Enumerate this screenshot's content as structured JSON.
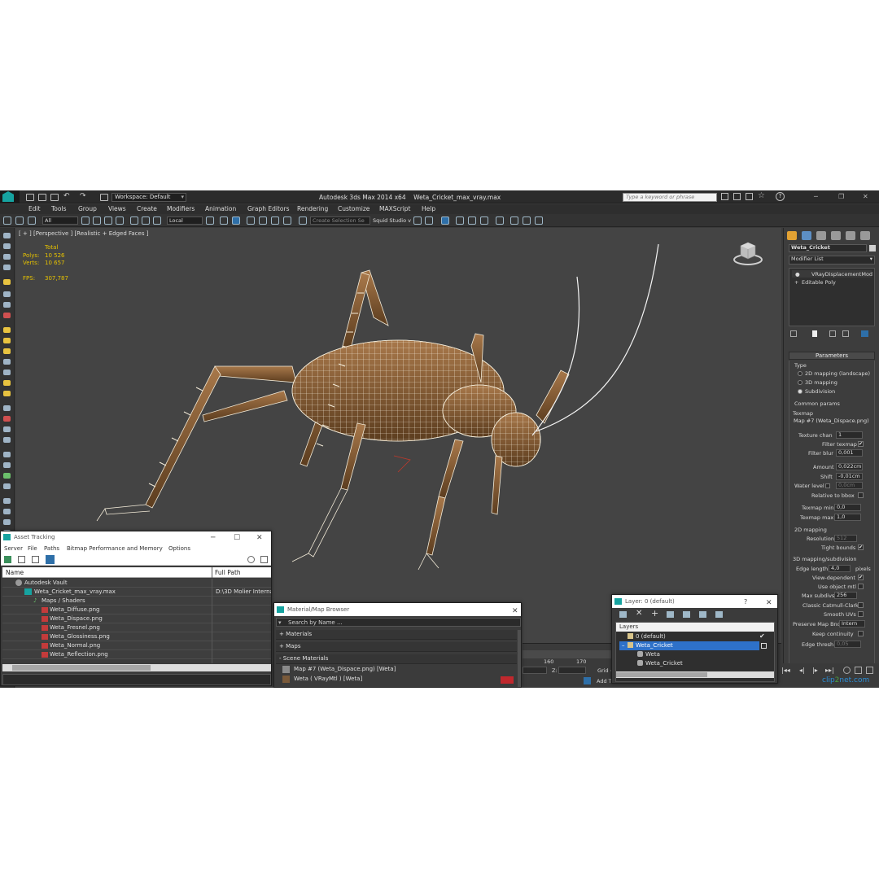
{
  "titlebar": {
    "workspace": "Workspace: Default",
    "app_title": "Autodesk 3ds Max  2014 x64",
    "file_title": "Weta_Cricket_max_vray.max",
    "search_placeholder": "Type a keyword or phrase"
  },
  "menubar": [
    "Edit",
    "Tools",
    "Group",
    "Views",
    "Create",
    "Modifiers",
    "Animation",
    "Graph Editors",
    "Rendering",
    "Customize",
    "MAXScript",
    "Help"
  ],
  "toolbar": {
    "filter_value": "All",
    "coord_value": "Local",
    "selection_set_placeholder": "Create Selection Se",
    "squid_label": "Squid Studio v"
  },
  "viewport": {
    "label": "[ + ] [Perspective ] [Realistic + Edged Faces ]",
    "stats_header": "Total",
    "polys_label": "Polys:",
    "polys_value": "10 526",
    "verts_label": "Verts:",
    "verts_value": "10 657",
    "fps_label": "FPS:",
    "fps_value": "307,787"
  },
  "command_panel": {
    "object_name": "Weta_Cricket",
    "modifier_list": "Modifier List",
    "stack": [
      "VRayDisplacementMod",
      "Editable Poly"
    ],
    "parameters_title": "Parameters",
    "type_label": "Type",
    "type_options": [
      "2D mapping (landscape)",
      "3D mapping",
      "Subdivision"
    ],
    "type_selected": "Subdivision",
    "common_params": "Common params",
    "texmap_label": "Texmap",
    "texmap_value": "Map #7 (Weta_Dispace.png)",
    "texture_chan_label": "Texture chan",
    "texture_chan_value": "1",
    "filter_texmap_label": "Filter texmap",
    "filter_blur_label": "Filter blur",
    "filter_blur_value": "0,001",
    "amount_label": "Amount",
    "amount_value": "0,022cm",
    "shift_label": "Shift",
    "shift_value": "-0,01cm",
    "water_level_label": "Water level",
    "water_level_value": "0,0cm",
    "relative_bbox_label": "Relative to bbox",
    "texmap_min_label": "Texmap min",
    "texmap_min_value": "0,0",
    "texmap_max_label": "Texmap max",
    "texmap_max_value": "1,0",
    "mapping2d_title": "2D mapping",
    "resolution_label": "Resolution",
    "resolution_value": "512",
    "tight_bounds_label": "Tight bounds",
    "mapping3d_title": "3D mapping/subdivision",
    "edge_length_label": "Edge length",
    "edge_length_value": "4,0",
    "pixels_label": "pixels",
    "view_dependent_label": "View-dependent",
    "use_object_mtl_label": "Use object mtl",
    "max_subdivs_label": "Max subdivs",
    "max_subdivs_value": "256",
    "classic_catmull_label": "Classic Catmull-Clark",
    "smooth_uvs_label": "Smooth UVs",
    "preserve_map_label": "Preserve Map Bnd",
    "preserve_map_value": "Intern",
    "keep_continuity_label": "Keep continuity",
    "edge_thresh_label": "Edge thresh",
    "edge_thresh_value": "0,05"
  },
  "asset_tracking": {
    "title": "Asset Tracking",
    "menu": [
      "Server",
      "File",
      "Paths",
      "Bitmap Performance and Memory",
      "Options"
    ],
    "col_name": "Name",
    "col_path": "Full Path",
    "rows": [
      {
        "name": "Autodesk Vault",
        "path": ""
      },
      {
        "name": "Weta_Cricket_max_vray.max",
        "path": "D:\\3D Molier Interna"
      },
      {
        "name": "Maps / Shaders",
        "path": ""
      },
      {
        "name": "Weta_Diffuse.png",
        "path": ""
      },
      {
        "name": "Weta_Dispace.png",
        "path": ""
      },
      {
        "name": "Weta_Fresnel.png",
        "path": ""
      },
      {
        "name": "Weta_Glossiness.png",
        "path": ""
      },
      {
        "name": "Weta_Normal.png",
        "path": ""
      },
      {
        "name": "Weta_Reflection.png",
        "path": ""
      }
    ]
  },
  "material_browser": {
    "title": "Material/Map Browser",
    "search_placeholder": "Search by Name ...",
    "sections": [
      "+ Materials",
      "+ Maps",
      "- Scene Materials"
    ],
    "items": [
      "Map #7 (Weta_Dispace.png)  [Weta]",
      "Weta  ( VRayMtl )  [Weta]"
    ]
  },
  "layers": {
    "title": "Layer: 0 (default)",
    "help": "?",
    "header": "Layers",
    "rows": [
      "0 (default)",
      "Weta_Cricket",
      "Weta",
      "Weta_Cricket"
    ]
  },
  "timeline": {
    "tick_160": "160",
    "tick_170": "170",
    "z_label": "Z:",
    "grid_label": "Grid =",
    "add_label": "Add T"
  },
  "watermark": {
    "part1": "clip",
    "part2": "2",
    "part3": "net",
    "part4": ".com"
  }
}
